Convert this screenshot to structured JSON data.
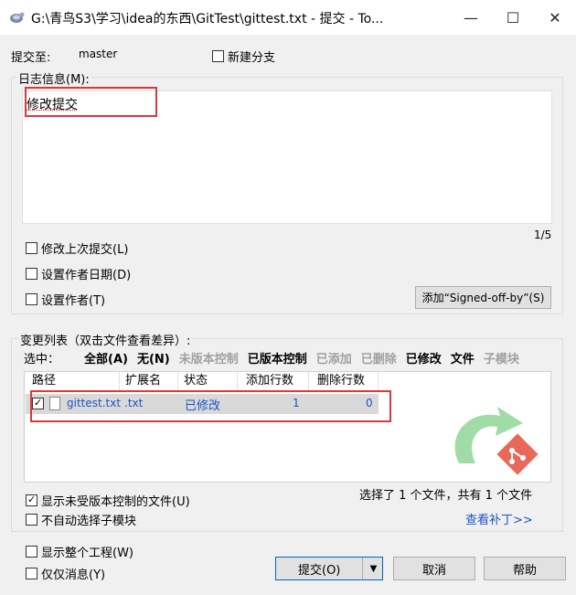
{
  "window": {
    "title": "G:\\青鸟S3\\学习\\idea的东西\\GitTest\\gittest.txt - 提交 - To...",
    "app_icon": "tortoise-icon",
    "controls": [
      "minimize-icon",
      "maximize-icon",
      "close-icon"
    ]
  },
  "commit_to": {
    "label": "提交至:",
    "branch": "master"
  },
  "new_branch": {
    "label": "新建分支",
    "checked": false
  },
  "message": {
    "label": "日志信息(M):",
    "text": "修改提交",
    "counter": "1/5"
  },
  "options": {
    "amend": {
      "label": "修改上次提交(L)",
      "checked": false
    },
    "set_date": {
      "label": "设置作者日期(D)",
      "checked": false
    },
    "set_author": {
      "label": "设置作者(T)",
      "checked": false
    },
    "signed_off_button": "添加“Signed-off-by”(S)"
  },
  "changes": {
    "label": "变更列表（双击文件查看差异）:",
    "select_label": "选中：",
    "filters": [
      {
        "label": "全部(A)",
        "enabled": true
      },
      {
        "label": "无(N)",
        "enabled": true
      },
      {
        "label": "未版本控制",
        "enabled": false
      },
      {
        "label": "已版本控制",
        "enabled": true
      },
      {
        "label": "已添加",
        "enabled": false
      },
      {
        "label": "已删除",
        "enabled": false
      },
      {
        "label": "已修改",
        "enabled": true
      },
      {
        "label": "文件",
        "enabled": true
      },
      {
        "label": "子模块",
        "enabled": false
      }
    ],
    "columns": [
      "路径",
      "扩展名",
      "状态",
      "添加行数",
      "删除行数"
    ],
    "rows": [
      {
        "checked": true,
        "path": "gittest.txt",
        "ext": ".txt",
        "status": "已修改",
        "added": "1",
        "deleted": "0"
      }
    ],
    "summary": "选择了 1 个文件，共有 1 个文件",
    "view_patch": "查看补丁>>"
  },
  "bottom_options": {
    "show_unversioned": {
      "label": "显示未受版本控制的文件(U)",
      "checked": true
    },
    "no_auto_submodule": {
      "label": "不自动选择子模块",
      "checked": false
    },
    "show_whole_project": {
      "label": "显示整个工程(W)",
      "checked": false
    },
    "message_only": {
      "label": "仅仅消息(Y)",
      "checked": false
    }
  },
  "buttons": {
    "commit": "提交(O)",
    "cancel": "取消",
    "help": "帮助"
  },
  "colors": {
    "link_blue": "#1a55c4",
    "highlight_red": "#d9393c",
    "accent_teal": "#0067c0"
  }
}
